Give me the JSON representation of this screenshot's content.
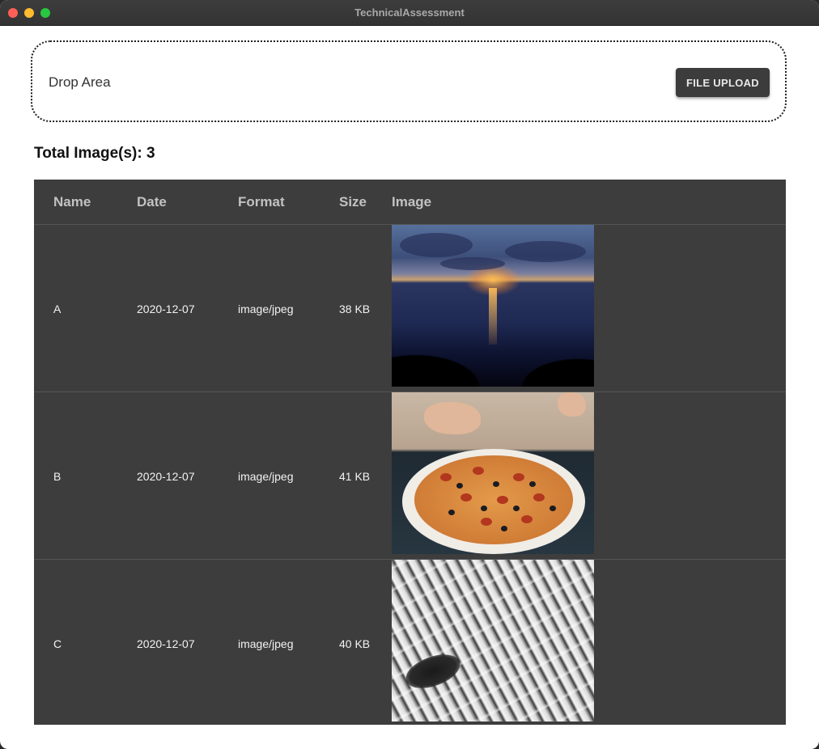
{
  "window": {
    "title": "TechnicalAssessment"
  },
  "drop_area": {
    "label": "Drop Area",
    "upload_button": "FILE UPLOAD"
  },
  "summary": {
    "total_label": "Total Image(s): 3"
  },
  "table": {
    "headers": {
      "name": "Name",
      "date": "Date",
      "format": "Format",
      "size": "Size",
      "image": "Image"
    },
    "rows": [
      {
        "name": "A",
        "date": "2020-12-07",
        "format": "image/jpeg",
        "size": "38 KB",
        "image": "sunset-over-sea-photo"
      },
      {
        "name": "B",
        "date": "2020-12-07",
        "format": "image/jpeg",
        "size": "41 KB",
        "image": "pizza-photo"
      },
      {
        "name": "C",
        "date": "2020-12-07",
        "format": "image/jpeg",
        "size": "40 KB",
        "image": "architecture-pattern-photo"
      }
    ]
  },
  "colors": {
    "titlebar": "#383838",
    "table_background": "#3d3d3d",
    "button_background": "#3c3c3c",
    "close": "#fe5f57",
    "minimize": "#febc2e",
    "maximize": "#28c840"
  }
}
